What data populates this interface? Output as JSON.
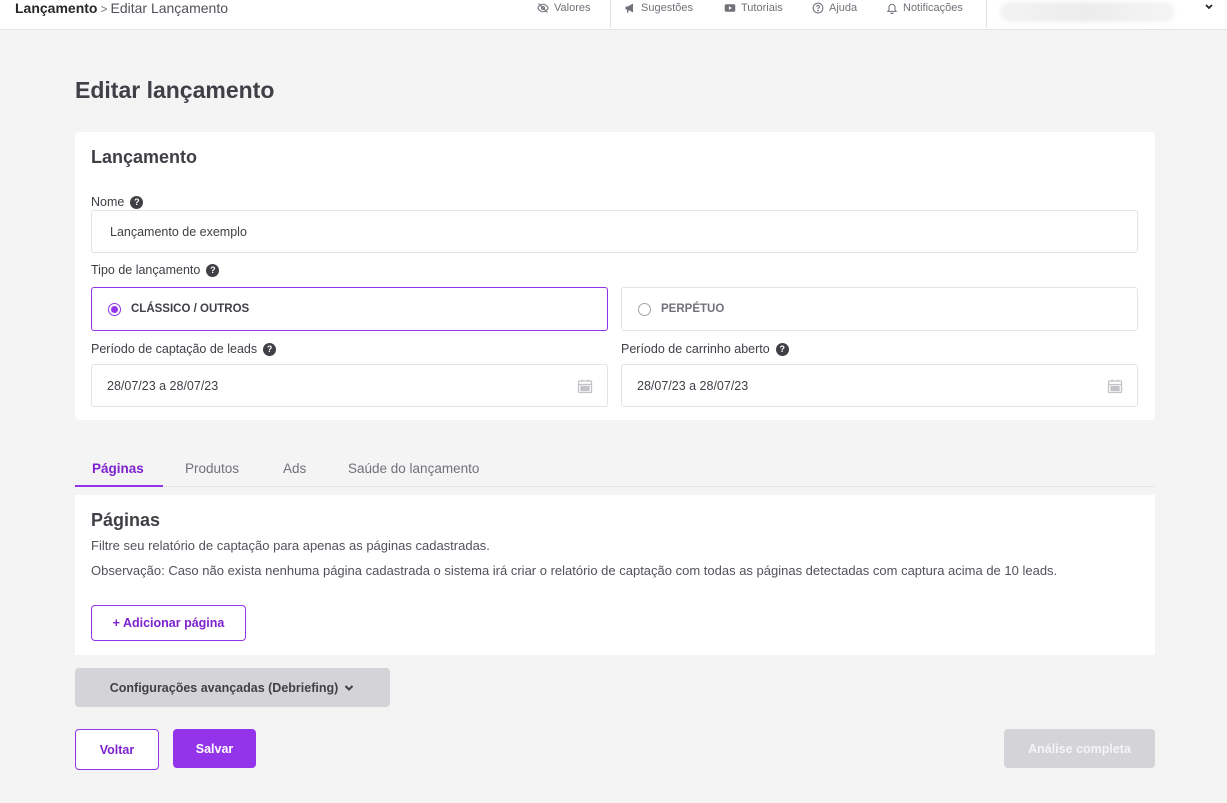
{
  "breadcrumb": {
    "root": "Lançamento",
    "separator": ">",
    "current": "Editar Lançamento"
  },
  "topnav": {
    "valores": "Valores",
    "sugestoes": "Sugestões",
    "tutoriais": "Tutoriais",
    "ajuda": "Ajuda",
    "notificacoes": "Notificações"
  },
  "page": {
    "title": "Editar lançamento"
  },
  "card": {
    "title": "Lançamento",
    "nome_label": "Nome",
    "nome_value": "Lançamento de exemplo",
    "tipo_label": "Tipo de lançamento",
    "tipo_options": [
      {
        "label": "CLÁSSICO / OUTROS",
        "selected": true
      },
      {
        "label": "PERPÉTUO",
        "selected": false
      }
    ],
    "captacao_label": "Período de captação de leads",
    "captacao_value": "28/07/23 a 28/07/23",
    "carrinho_label": "Período de carrinho aberto",
    "carrinho_value": "28/07/23 a 28/07/23",
    "help_glyph": "?"
  },
  "tabs": [
    {
      "label": "Páginas",
      "active": true
    },
    {
      "label": "Produtos",
      "active": false
    },
    {
      "label": "Ads",
      "active": false
    },
    {
      "label": "Saúde do lançamento",
      "active": false
    }
  ],
  "panel": {
    "title": "Páginas",
    "description": "Filtre seu relatório de captação para apenas as páginas cadastradas.",
    "note": "Observação: Caso não exista nenhuma página cadastrada o sistema irá criar o relatório de captação com todas as páginas detectadas com captura acima de 10 leads.",
    "add_button": "+ Adicionar página"
  },
  "advanced": {
    "label": "Configurações avançadas (Debriefing)"
  },
  "actions": {
    "back": "Voltar",
    "save": "Salvar",
    "analysis": "Análise completa"
  },
  "colors": {
    "accent": "#9333ea",
    "background": "#f4f4f5",
    "disabled": "#d4d4d8"
  }
}
